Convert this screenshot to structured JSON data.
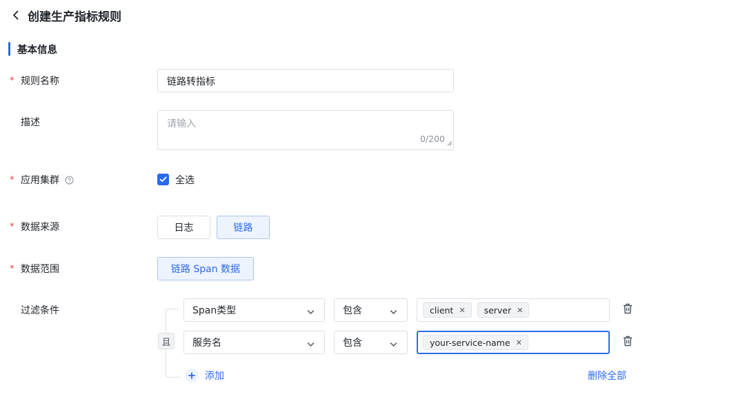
{
  "header": {
    "title": "创建生产指标规则"
  },
  "section": {
    "title": "基本信息"
  },
  "form": {
    "rule_name": {
      "label": "规则名称",
      "required_mark": "*",
      "value": "链路转指标"
    },
    "description": {
      "label": "描述",
      "placeholder": "请输入",
      "counter": "0/200"
    },
    "cluster": {
      "label": "应用集群",
      "required_mark": "*",
      "checkbox_label": "全选",
      "checked": true
    },
    "source": {
      "label": "数据来源",
      "required_mark": "*",
      "options": [
        "日志",
        "链路"
      ],
      "selected": "链路"
    },
    "scope": {
      "label": "数据范围",
      "required_mark": "*",
      "option": "链路 Span 数据"
    },
    "filter": {
      "label": "过滤条件",
      "logic": "且",
      "rows": [
        {
          "field": "Span类型",
          "operator": "包含",
          "tags": [
            "client",
            "server"
          ]
        },
        {
          "field": "服务名",
          "operator": "包含",
          "tags": [
            "your-service-name"
          ]
        }
      ],
      "add_label": "添加",
      "delete_all_label": "删除全部"
    }
  },
  "colors": {
    "accent": "#2a6ae9",
    "required": "#e5413b",
    "border": "#dcdfe5"
  },
  "icons": [
    "chevron-left-icon",
    "help-circle-icon",
    "check-icon",
    "chevron-down-icon",
    "close-icon",
    "trash-icon",
    "plus-icon",
    "resize-handle-icon"
  ]
}
